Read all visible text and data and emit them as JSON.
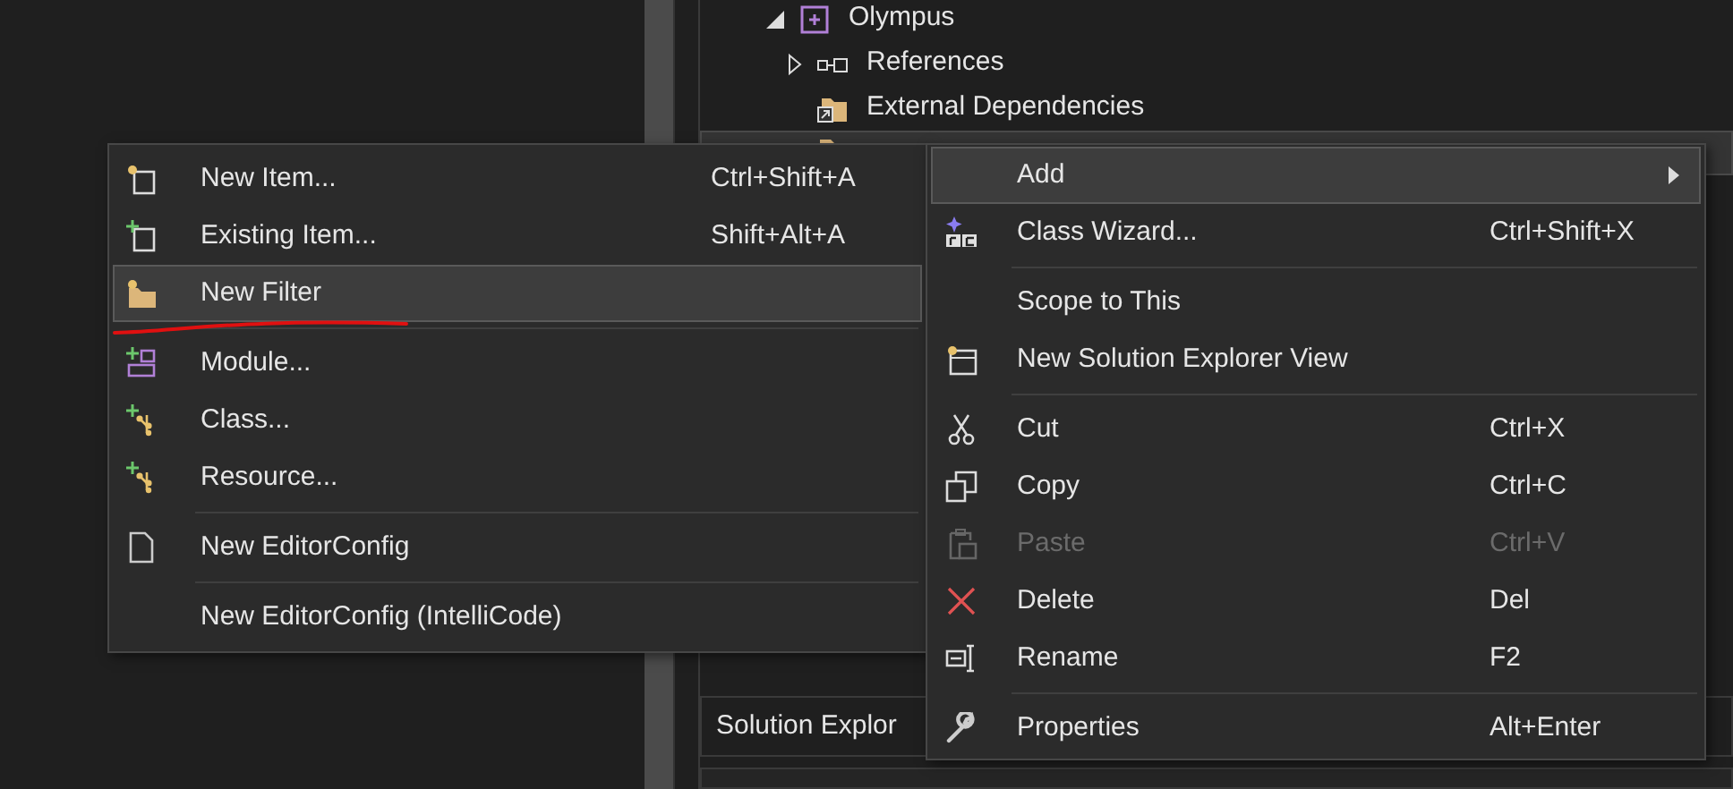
{
  "tree": [
    {
      "label": "Olympus",
      "expanded": true,
      "selected": false
    },
    {
      "label": "References",
      "expanded": false,
      "selected": false
    },
    {
      "label": "External Dependencies",
      "selected": false
    },
    {
      "selected": true
    }
  ],
  "panel_tabs": [
    {
      "label": "Solution Explor"
    }
  ],
  "add_submenu": [
    {
      "kind": "item",
      "label": "New Item...",
      "shortcut": "Ctrl+Shift+A",
      "selected": false
    },
    {
      "kind": "item",
      "label": "Existing Item...",
      "shortcut": "Shift+Alt+A",
      "selected": false
    },
    {
      "kind": "item",
      "label": "New Filter",
      "selected": true
    },
    {
      "kind": "separator"
    },
    {
      "kind": "item",
      "label": "Module...",
      "selected": false
    },
    {
      "kind": "item",
      "label": "Class...",
      "selected": false
    },
    {
      "kind": "item",
      "label": "Resource...",
      "selected": false
    },
    {
      "kind": "separator"
    },
    {
      "kind": "item",
      "label": "New EditorConfig",
      "selected": false
    },
    {
      "kind": "separator"
    },
    {
      "kind": "item",
      "label": "New EditorConfig (IntelliCode)",
      "selected": false
    }
  ],
  "context_menu": [
    {
      "kind": "item",
      "label": "Add",
      "submenu": true,
      "selected": true,
      "disabled": false
    },
    {
      "kind": "item",
      "label": "Class Wizard...",
      "shortcut": "Ctrl+Shift+X",
      "selected": false,
      "disabled": false
    },
    {
      "kind": "separator"
    },
    {
      "kind": "item",
      "label": "Scope to This",
      "selected": false,
      "disabled": false
    },
    {
      "kind": "item",
      "label": "New Solution Explorer View",
      "selected": false,
      "disabled": false
    },
    {
      "kind": "separator"
    },
    {
      "kind": "item",
      "label": "Cut",
      "shortcut": "Ctrl+X",
      "selected": false,
      "disabled": false
    },
    {
      "kind": "item",
      "label": "Copy",
      "shortcut": "Ctrl+C",
      "selected": false,
      "disabled": false
    },
    {
      "kind": "item",
      "label": "Paste",
      "shortcut": "Ctrl+V",
      "selected": false,
      "disabled": true
    },
    {
      "kind": "item",
      "label": "Delete",
      "shortcut": "Del",
      "selected": false,
      "disabled": false
    },
    {
      "kind": "item",
      "label": "Rename",
      "shortcut": "F2",
      "selected": false,
      "disabled": false
    },
    {
      "kind": "separator"
    },
    {
      "kind": "item",
      "label": "Properties",
      "shortcut": "Alt+Enter",
      "selected": false,
      "disabled": false
    }
  ]
}
